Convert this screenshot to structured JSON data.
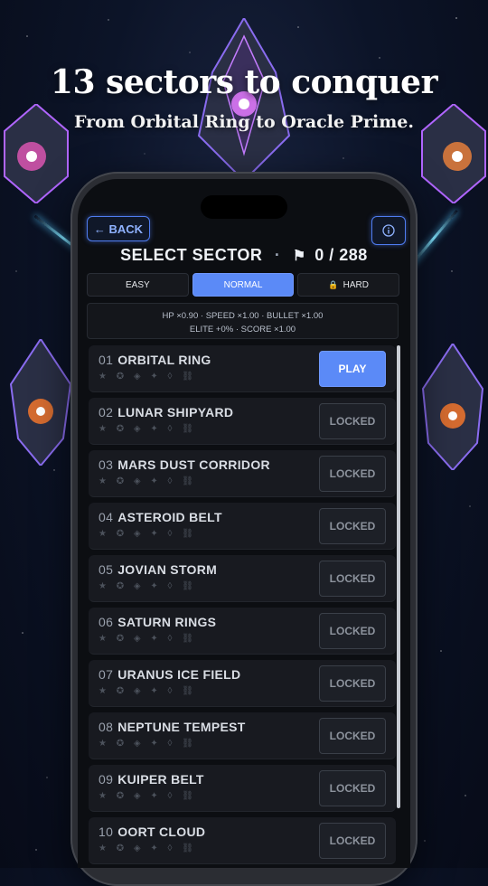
{
  "promo": {
    "headline": "13 sectors to conquer",
    "subheadline": "From Orbital Ring to Oracle Prime."
  },
  "header": {
    "back_label": "← BACK",
    "title": "SELECT SECTOR",
    "separator": "·",
    "progress": "0 / 288",
    "info_icon": "info-icon"
  },
  "difficulty": {
    "options": [
      "EASY",
      "NORMAL",
      "HARD"
    ],
    "selected": "NORMAL",
    "hard_locked": true
  },
  "modifiers": {
    "line1": "HP ×0.90  ·  SPEED ×1.00  ·  BULLET ×1.00",
    "line2": "ELITE +0%  ·  SCORE ×1.00"
  },
  "sectors": [
    {
      "num": "01",
      "name": "ORBITAL RING",
      "action": "PLAY"
    },
    {
      "num": "02",
      "name": "LUNAR SHIPYARD",
      "action": "LOCKED"
    },
    {
      "num": "03",
      "name": "MARS DUST CORRIDOR",
      "action": "LOCKED"
    },
    {
      "num": "04",
      "name": "ASTEROID BELT",
      "action": "LOCKED"
    },
    {
      "num": "05",
      "name": "JOVIAN STORM",
      "action": "LOCKED"
    },
    {
      "num": "06",
      "name": "SATURN RINGS",
      "action": "LOCKED"
    },
    {
      "num": "07",
      "name": "URANUS ICE FIELD",
      "action": "LOCKED"
    },
    {
      "num": "08",
      "name": "NEPTUNE TEMPEST",
      "action": "LOCKED"
    },
    {
      "num": "09",
      "name": "KUIPER BELT",
      "action": "LOCKED"
    },
    {
      "num": "10",
      "name": "OORT CLOUD",
      "action": "LOCKED"
    }
  ],
  "row_icons": "★ ✪ ◈ ✦ ◊ ⛓",
  "colors": {
    "accent": "#5b8af7",
    "background": "#0c0e12",
    "locked_text": "#8c929c",
    "lock_icon": "#e1b54a"
  }
}
